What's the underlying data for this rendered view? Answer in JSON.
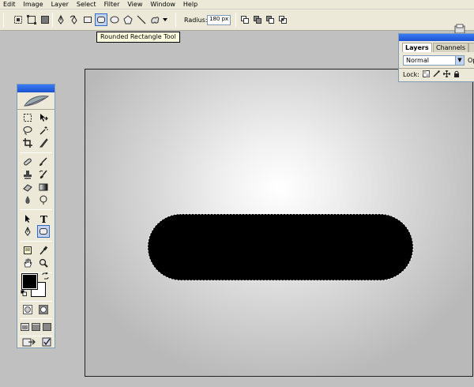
{
  "menu": [
    "Edit",
    "Image",
    "Layer",
    "Select",
    "Filter",
    "View",
    "Window",
    "Help"
  ],
  "options": {
    "radius_label": "Radius:",
    "radius_value": "180 px"
  },
  "tooltip": "Rounded Rectangle Tool",
  "layers": {
    "tabs": [
      "Layers",
      "Channels",
      ""
    ],
    "blend_mode": "Normal",
    "opacity_label": "Op",
    "lock_label": "Lock:"
  },
  "colors": {
    "foreground": "#000000",
    "background": "#ffffff",
    "accent": "#316ac5",
    "panel_title": "#1c52d0"
  }
}
